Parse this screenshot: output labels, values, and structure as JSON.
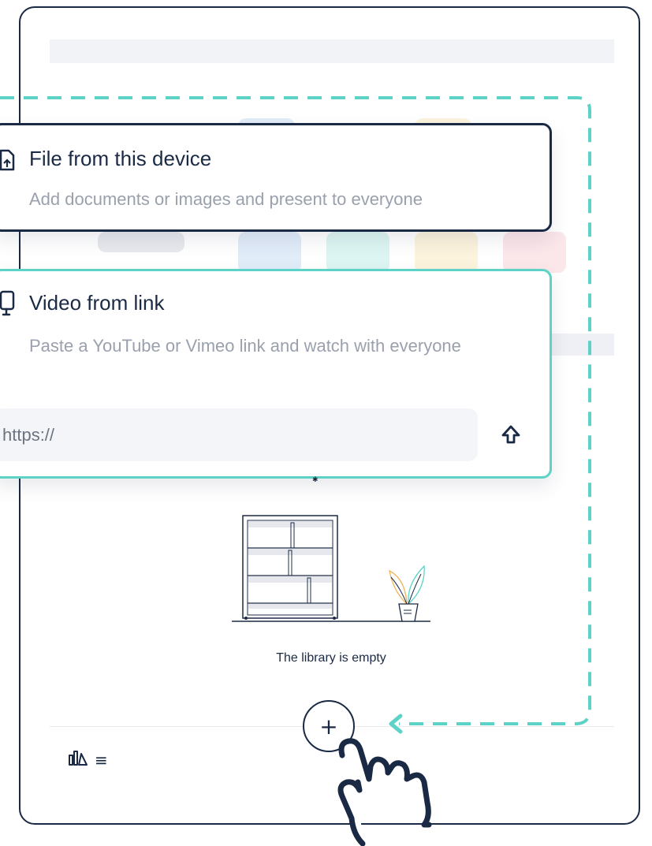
{
  "options": {
    "file": {
      "title": "File from this device",
      "description": "Add documents or images and present to everyone",
      "icon": "file-upload-icon"
    },
    "video": {
      "title": "Video from link",
      "description": "Paste a YouTube or Vimeo link and watch with everyone",
      "icon": "video-link-icon",
      "url_placeholder": "https://",
      "submit_icon": "arrow-up-outline-icon"
    }
  },
  "library": {
    "empty_text": "The library is empty",
    "add_label": "+",
    "menu_icon": "≡"
  },
  "colors": {
    "navy": "#1b2a44",
    "teal": "#5cd3c6",
    "muted_text": "#9aa1ad"
  }
}
